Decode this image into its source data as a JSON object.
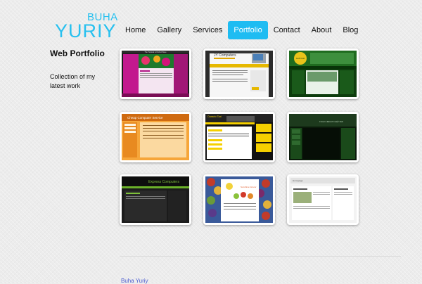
{
  "header": {
    "logo_first": "BUHA",
    "logo_last": "YURIY",
    "brand_color": "#27c0ef"
  },
  "nav": {
    "active_color": "#1ebcf2",
    "items": [
      {
        "label": "Home"
      },
      {
        "label": "Gallery"
      },
      {
        "label": "Services"
      },
      {
        "label": "Portfolio",
        "active": true
      },
      {
        "label": "Contact"
      },
      {
        "label": "About"
      },
      {
        "label": "Blog"
      }
    ]
  },
  "sidebar": {
    "title": "Web Portfolio",
    "description": "Collection of my latest work"
  },
  "portfolio": {
    "thumbnails": [
      {
        "header_text": "The Tropical & Orchid Place"
      },
      {
        "header_text": "JY Computers"
      },
      {
        "header_text": "Golf Club"
      },
      {
        "header_text": "Cheap Computer Service"
      },
      {
        "header_text": "Oceanic Taxi"
      },
      {
        "header_text": "Clover Ranch Golf Club"
      },
      {
        "header_text": "Express Computers"
      },
      {
        "header_text": "Sunshine Grocer"
      },
      {
        "header_text": "Homepage"
      }
    ]
  },
  "footer": {
    "link_label": "Buha Yuriy"
  }
}
